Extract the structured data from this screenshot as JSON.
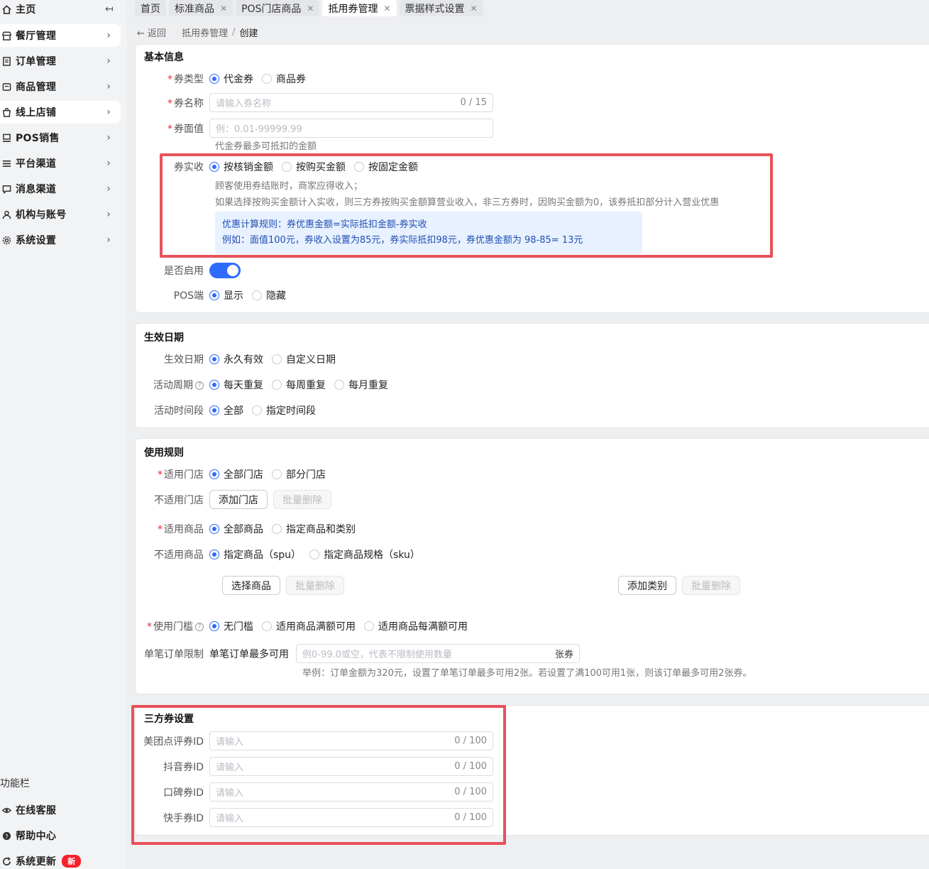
{
  "sidebar": {
    "collapse_icon": "↤",
    "items": [
      {
        "label": "主页",
        "icon": "home-icon"
      },
      {
        "label": "餐厅管理",
        "icon": "store-icon"
      },
      {
        "label": "订单管理",
        "icon": "order-icon"
      },
      {
        "label": "商品管理",
        "icon": "product-icon"
      },
      {
        "label": "线上店铺",
        "icon": "shop-icon"
      },
      {
        "label": "POS销售",
        "icon": "pos-icon"
      },
      {
        "label": "平台渠道",
        "icon": "channel-icon"
      },
      {
        "label": "消息渠道",
        "icon": "message-icon"
      },
      {
        "label": "机构与账号",
        "icon": "org-icon"
      },
      {
        "label": "系统设置",
        "icon": "settings-icon"
      }
    ],
    "function_bar_title": "功能栏",
    "bottom_items": [
      {
        "label": "在线客服"
      },
      {
        "label": "帮助中心"
      },
      {
        "label": "系统更新",
        "badge": "新"
      }
    ]
  },
  "tabs": [
    {
      "label": "首页",
      "closable": false
    },
    {
      "label": "标准商品",
      "closable": true
    },
    {
      "label": "POS门店商品",
      "closable": true
    },
    {
      "label": "抵用券管理",
      "closable": true,
      "active": true
    },
    {
      "label": "票据样式设置",
      "closable": true
    }
  ],
  "breadcrumb": {
    "back": "返回",
    "parent": "抵用券管理",
    "separator": "/",
    "current": "创建"
  },
  "basic": {
    "title": "基本信息",
    "coupon_type_label": "券类型",
    "coupon_type_options": [
      "代金券",
      "商品券"
    ],
    "coupon_name_label": "券名称",
    "coupon_name_placeholder": "请输入券名称",
    "coupon_name_count": "0 / 15",
    "face_value_label": "券面值",
    "face_value_placeholder": "例：0.01-99999.99",
    "face_value_hint": "代金券最多可抵扣的金额",
    "actual_income_label": "券实收",
    "actual_income_options": [
      "按核销金额",
      "按购买金额",
      "按固定金额"
    ],
    "actual_income_hint1": "顾客使用券结账时，商家应得收入；",
    "actual_income_hint2": "如果选择按购买金额计入实收，则三方券按购买金额算营业收入，非三方券时，因购买金额为0，该券抵扣部分计入营业优惠",
    "tip_line1": "优惠计算规则：券优惠金额=实际抵扣金额-券实收",
    "tip_line2": "例如：面值100元，券收入设置为85元，券实际抵扣98元，券优惠金额为 98-85= 13元",
    "enabled_label": "是否启用",
    "pos_label": "POS端",
    "pos_options": [
      "显示",
      "隐藏"
    ]
  },
  "effective": {
    "title": "生效日期",
    "date_label": "生效日期",
    "date_options": [
      "永久有效",
      "自定义日期"
    ],
    "cycle_label": "活动周期",
    "cycle_options": [
      "每天重复",
      "每周重复",
      "每月重复"
    ],
    "period_label": "活动时间段",
    "period_options": [
      "全部",
      "指定时间段"
    ],
    "help_icon": "?"
  },
  "rules": {
    "title": "使用规则",
    "stores_label": "适用门店",
    "stores_options": [
      "全部门店",
      "部分门店"
    ],
    "excluded_stores_label": "不适用门店",
    "add_store_button": "添加门店",
    "batch_delete_button": "批量删除",
    "goods_label": "适用商品",
    "goods_options": [
      "全部商品",
      "指定商品和类别"
    ],
    "excluded_goods_label": "不适用商品",
    "excluded_goods_options": [
      "指定商品（spu）",
      "指定商品规格（sku）"
    ],
    "select_goods_button": "选择商品",
    "add_category_button": "添加类别",
    "threshold_label": "使用门槛",
    "threshold_options": [
      "无门槛",
      "适用商品满额可用",
      "适用商品每满额可用"
    ],
    "limit_label": "单笔订单限制",
    "limit_prefix": "单笔订单最多可用",
    "limit_placeholder": "例0-99.0或空，代表不限制使用数量",
    "limit_unit": "张券",
    "limit_hint": "举例：订单金额为320元，设置了单笔订单最多可用2张。若设置了满100可用1张，则该订单最多可用2张券。"
  },
  "third_party": {
    "title": "三方券设置",
    "fields": [
      {
        "label": "美团点评券ID",
        "placeholder": "请输入",
        "count": "0 / 100"
      },
      {
        "label": "抖音券ID",
        "placeholder": "请输入",
        "count": "0 / 100"
      },
      {
        "label": "口碑券ID",
        "placeholder": "请输入",
        "count": "0 / 100"
      },
      {
        "label": "快手券ID",
        "placeholder": "请输入",
        "count": "0 / 100"
      }
    ]
  },
  "colors": {
    "primary": "#2f6bff",
    "highlight_border": "#e8515a",
    "required": "#f5222d",
    "tip_bg": "#e8f1ff"
  }
}
